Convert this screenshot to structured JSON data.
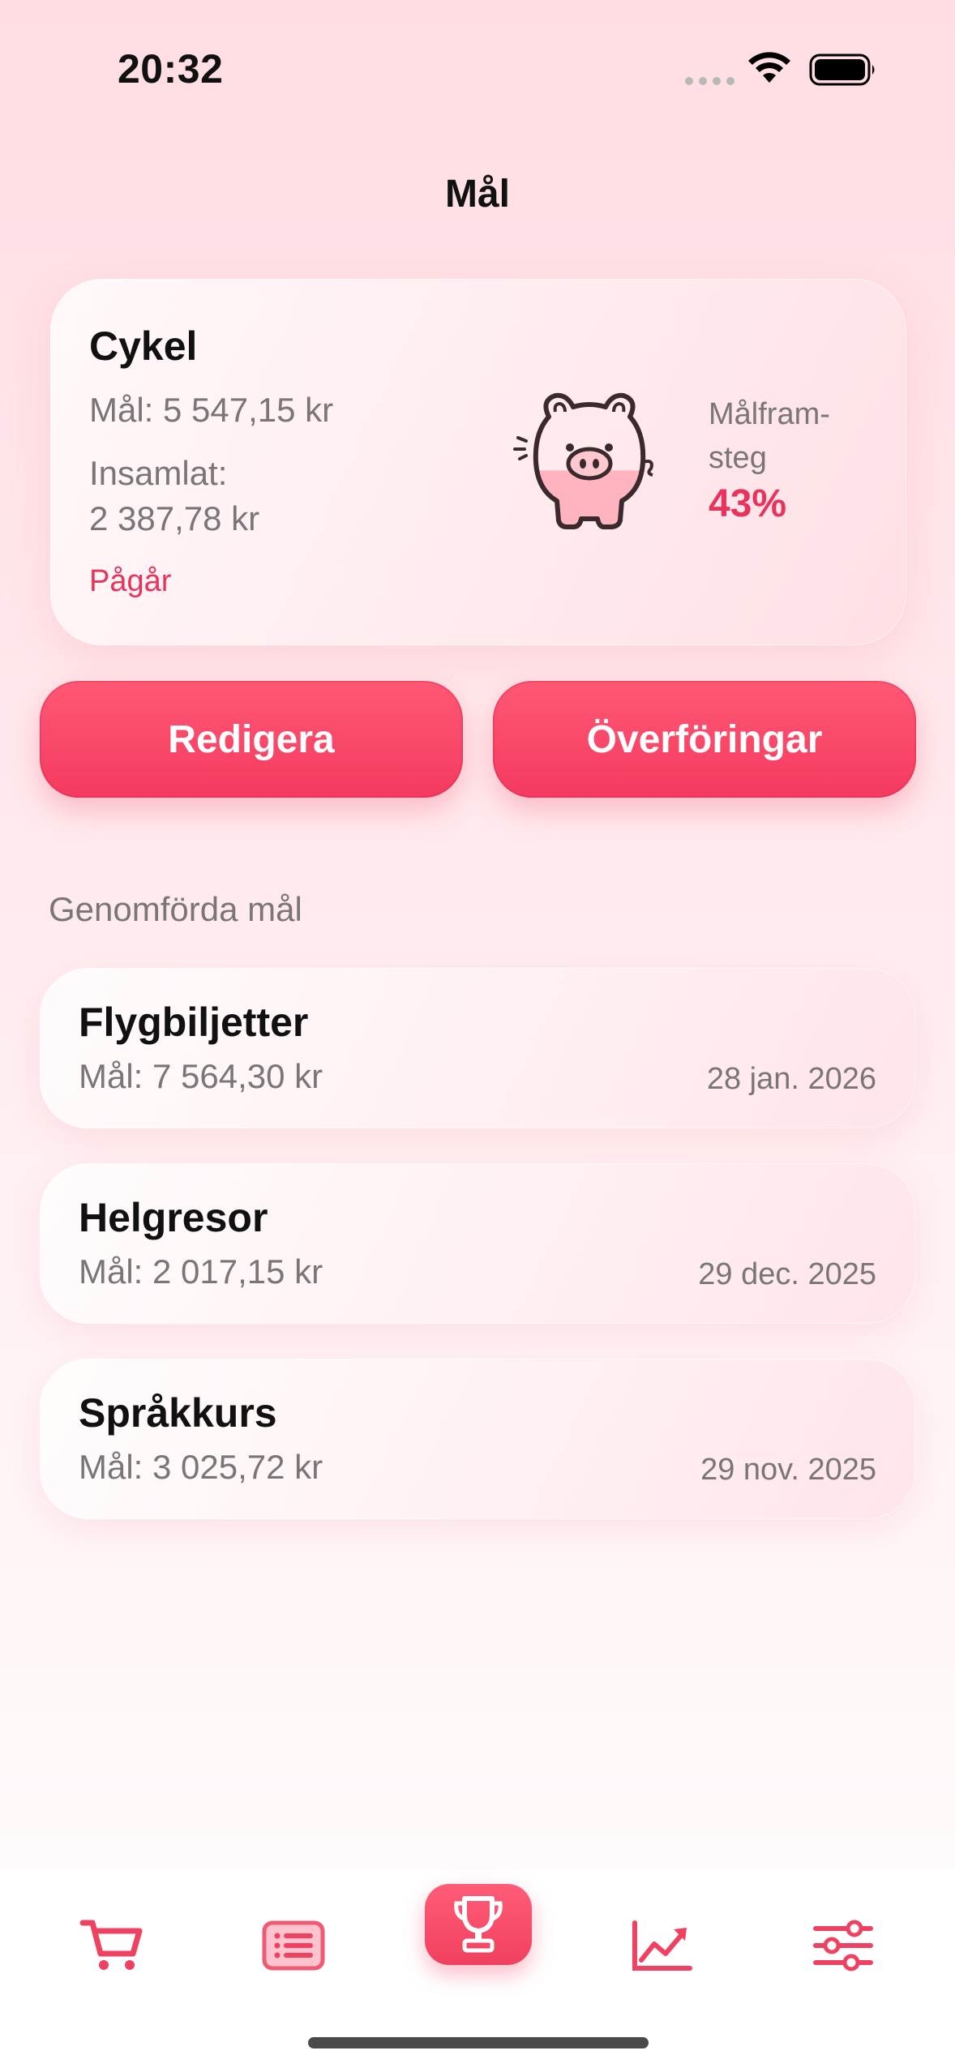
{
  "status_bar": {
    "time": "20:32"
  },
  "page": {
    "title": "Mål"
  },
  "active_goal": {
    "name": "Cykel",
    "target": "Mål: 5 547,15 kr",
    "saved_label": "Insamlat:",
    "saved_value": "2 387,78 kr",
    "status": "Pågår",
    "progress_label": "Målfram-steg",
    "progress_value": "43%",
    "progress_fraction": 0.43,
    "icon": "piggy-bank-icon"
  },
  "actions": {
    "edit": "Redigera",
    "transfers": "Överföringar"
  },
  "completed": {
    "title": "Genomförda mål",
    "items": [
      {
        "name": "Flygbiljetter",
        "target": "Mål: 7 564,30 kr",
        "date": "28 jan. 2026"
      },
      {
        "name": "Helgresor",
        "target": "Mål: 2 017,15 kr",
        "date": "29 dec. 2025"
      },
      {
        "name": "Språkkurs",
        "target": "Mål: 3 025,72 kr",
        "date": "29 nov. 2025"
      }
    ]
  },
  "tabs": [
    {
      "icon": "cart-icon",
      "active": false
    },
    {
      "icon": "list-icon",
      "active": false
    },
    {
      "icon": "trophy-icon",
      "active": true
    },
    {
      "icon": "chart-icon",
      "active": false
    },
    {
      "icon": "sliders-icon",
      "active": false
    }
  ],
  "colors": {
    "accent": "#f43a5f",
    "accent_text": "#e8345c",
    "muted": "#7a7577"
  }
}
